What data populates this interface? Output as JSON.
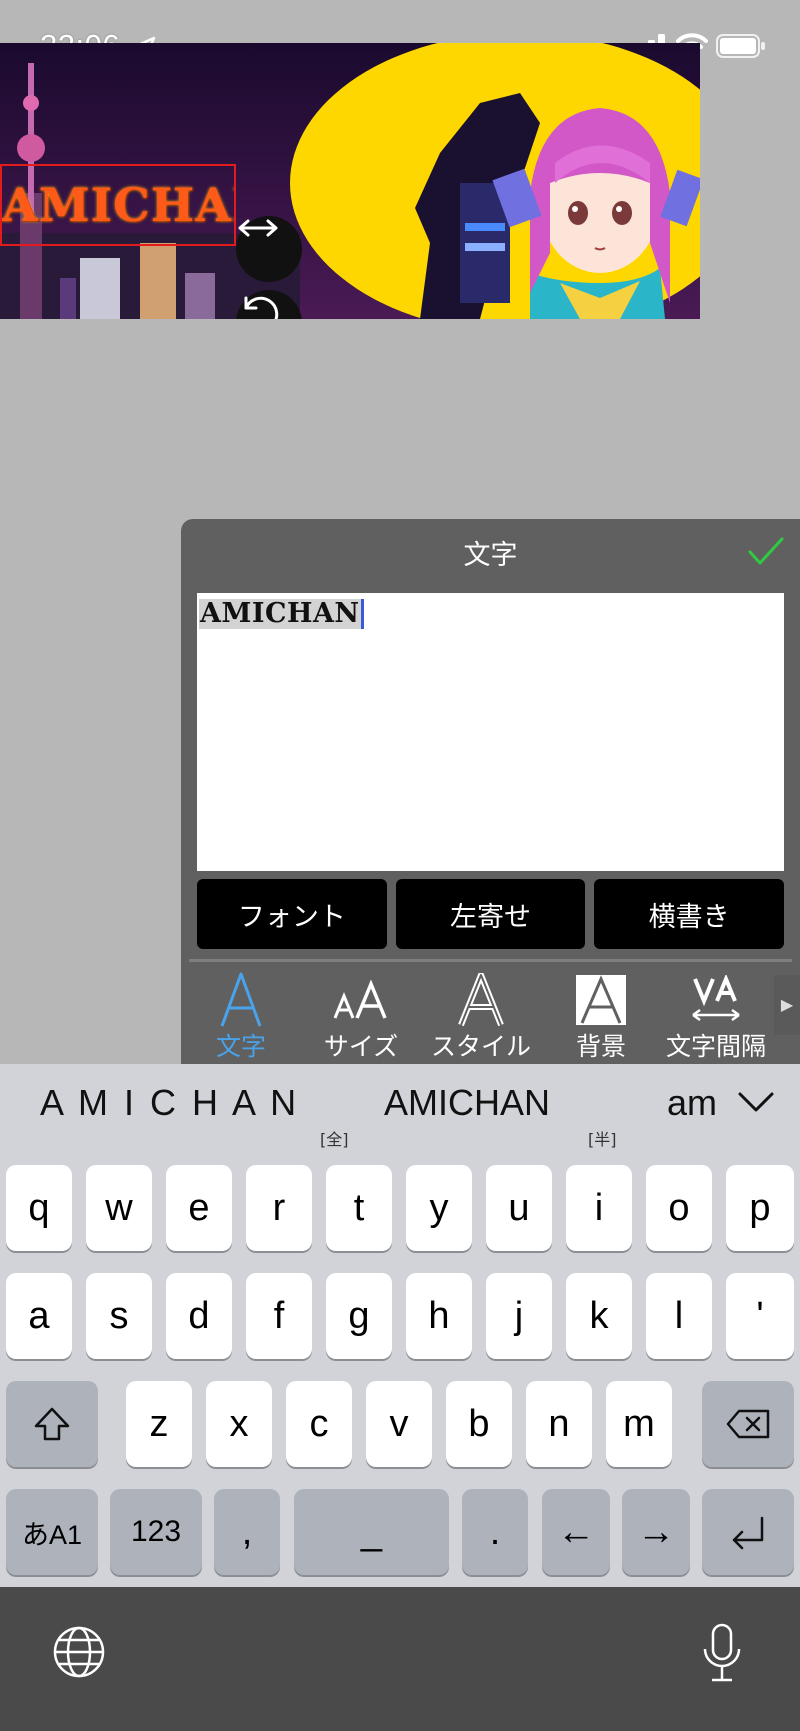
{
  "status_bar": {
    "time": "22:06",
    "icons": [
      "location-arrow-icon",
      "cellular-signal-icon",
      "wifi-icon",
      "battery-icon"
    ]
  },
  "banner": {
    "text_overlay": "AMICHAN",
    "handles": [
      "resize-handle-icon",
      "rotate-handle-icon"
    ]
  },
  "panel": {
    "title": "文字",
    "confirm_icon": "checkmark-icon",
    "text_value": "AMICHAN",
    "option_buttons": [
      "フォント",
      "左寄せ",
      "横書き"
    ],
    "tools": [
      {
        "label": "文字",
        "icon": "text-A-icon",
        "active": true
      },
      {
        "label": "サイズ",
        "icon": "size-AA-icon",
        "active": false
      },
      {
        "label": "スタイル",
        "icon": "outline-A-icon",
        "active": false
      },
      {
        "label": "背景",
        "icon": "background-A-icon",
        "active": false
      },
      {
        "label": "文字間隔",
        "icon": "letter-spacing-VA-icon",
        "active": false
      }
    ],
    "more_icon": "triangle-right-icon",
    "colors": {
      "active": "#4aa3ea",
      "check": "#2ecc40"
    }
  },
  "keyboard": {
    "suggestions": [
      {
        "text": "A M I C H A N",
        "note": "[全]"
      },
      {
        "text": "AMICHAN",
        "note": "[半]"
      },
      {
        "text": "am",
        "note": ""
      }
    ],
    "row1": [
      "q",
      "w",
      "e",
      "r",
      "t",
      "y",
      "u",
      "i",
      "o",
      "p"
    ],
    "row2": [
      "a",
      "s",
      "d",
      "f",
      "g",
      "h",
      "j",
      "k",
      "l",
      "'"
    ],
    "row3": [
      "z",
      "x",
      "c",
      "v",
      "b",
      "n",
      "m"
    ],
    "row4": [
      "あA1",
      "123",
      ",",
      "_",
      ".",
      "←",
      "→"
    ],
    "special_icons": [
      "shift-icon",
      "backspace-icon",
      "return-icon",
      "globe-icon",
      "microphone-icon"
    ]
  }
}
